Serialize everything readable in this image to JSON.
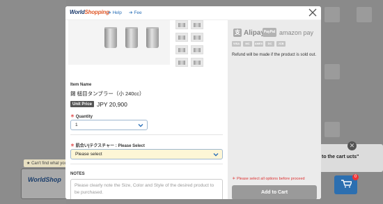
{
  "background": {
    "hint_text": "Can't find what you",
    "ws_logo": "WorldShop",
    "cart_popup_text": "to the cart ucts\"",
    "cart_badge": "0"
  },
  "modal": {
    "logo": {
      "main": "World",
      "accent": "Shopping"
    },
    "links": {
      "help": "Help",
      "fee": "Fee"
    },
    "item": {
      "name_label": "Item Name",
      "name": "錫 槌目タンブラー（小 240cc）",
      "unit_price_label": "Unit Price",
      "price": "JPY 20,900"
    },
    "quantity": {
      "label": "Quantity",
      "value": "1"
    },
    "texture": {
      "label": "肌合い|テクスチャー : Please Select",
      "value": "Please select"
    },
    "notes": {
      "label": "NOTES",
      "placeholder": "Please clearly note the Size, Color and Style of the desired product to be purchased."
    },
    "payment": {
      "alipay": "Alipay",
      "paypal": "PayPal",
      "amazonpay": "amazon pay",
      "cards": [
        "VISA",
        "MC",
        "AMEX",
        "DC",
        "JCB"
      ]
    },
    "refund_note": "Refund will be made if the product is sold out.",
    "warning": "Please select all options before proceed",
    "add_to_cart": "Add to Cart"
  }
}
